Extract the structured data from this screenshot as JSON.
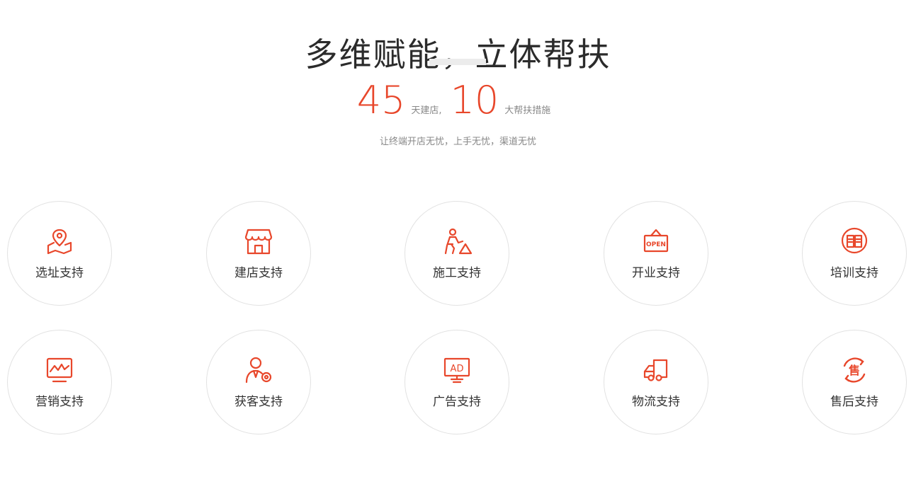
{
  "header": {
    "title": "多维赋能，立体帮扶",
    "stat1_value": "45",
    "stat1_text": "天建店,",
    "stat2_value": "10",
    "stat2_text": "大帮扶措施",
    "subtitle": "让终端开店无忧，上手无忧，渠道无忧"
  },
  "accent_color": "#e8472b",
  "services": [
    {
      "label": "选址支持",
      "icon": "location-map-icon"
    },
    {
      "label": "建店支持",
      "icon": "storefront-icon"
    },
    {
      "label": "施工支持",
      "icon": "construction-worker-icon"
    },
    {
      "label": "开业支持",
      "icon": "open-sign-icon"
    },
    {
      "label": "培训支持",
      "icon": "book-icon"
    },
    {
      "label": "营销支持",
      "icon": "chart-monitor-icon"
    },
    {
      "label": "获客支持",
      "icon": "customer-icon"
    },
    {
      "label": "广告支持",
      "icon": "ad-screen-icon"
    },
    {
      "label": "物流支持",
      "icon": "delivery-truck-icon"
    },
    {
      "label": "售后支持",
      "icon": "after-sales-icon"
    }
  ]
}
